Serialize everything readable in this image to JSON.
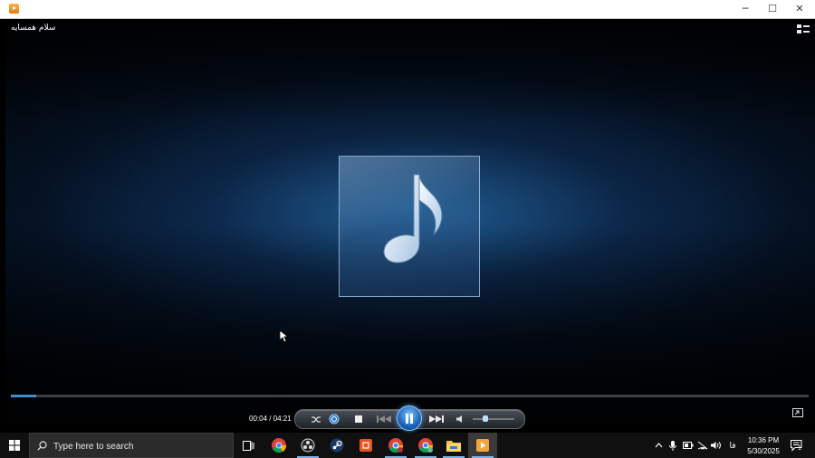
{
  "window": {
    "app_icon": "media-player-icon",
    "minimize_glyph": "─",
    "maximize_glyph": "☐",
    "close_glyph": "✕"
  },
  "player": {
    "track_title": "سلام همسایه",
    "album_art_icon": "music-note-icon",
    "progress_fraction": 0.015,
    "time_display": "00:04 / 04:21",
    "volume_fraction": 0.3,
    "accent_color": "#3b8fd4"
  },
  "taskbar": {
    "search_placeholder": "Type here to search",
    "language": "فا",
    "time": "10:36 PM",
    "date": "5/30/2025",
    "notification_count": "1",
    "pinned_apps": [
      "task-view",
      "chrome",
      "obs",
      "steam",
      "office",
      "chrome-profile-1",
      "chrome-profile-2",
      "file-explorer",
      "media-player"
    ]
  }
}
